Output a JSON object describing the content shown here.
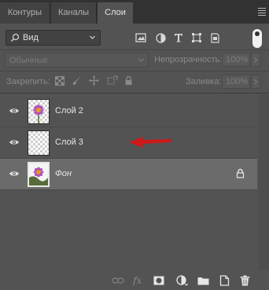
{
  "tabs": [
    {
      "label": "Контуры"
    },
    {
      "label": "Каналы"
    },
    {
      "label": "Слои"
    }
  ],
  "filter": {
    "kind_label": "Вид",
    "icons": [
      "image-filter-icon",
      "adjustment-filter-icon",
      "type-filter-icon",
      "shape-filter-icon",
      "smart-object-filter-icon"
    ]
  },
  "blend": {
    "mode": "Обычные",
    "opacity_label": "Непрозрачность:",
    "opacity_value": "100%"
  },
  "lock": {
    "label": "Закрепить:",
    "fill_label": "Заливка:",
    "fill_value": "100%"
  },
  "layers": [
    {
      "name": "Слой 2",
      "visible": true,
      "thumbnail": "flower"
    },
    {
      "name": "Слой 3",
      "visible": true,
      "thumbnail": "transparent"
    },
    {
      "name": "Фон",
      "visible": true,
      "thumbnail": "flower",
      "locked": true,
      "selected": true
    }
  ],
  "annotation": {
    "color": "#cc1a1a"
  },
  "colors": {
    "panel": "#535353",
    "tabbar": "#323232",
    "selected_row": "#6b6b6b"
  },
  "bottom_icons": [
    "link-layers-icon",
    "fx-icon",
    "add-mask-icon",
    "new-adjustment-icon",
    "new-group-icon",
    "new-layer-icon",
    "delete-icon"
  ]
}
